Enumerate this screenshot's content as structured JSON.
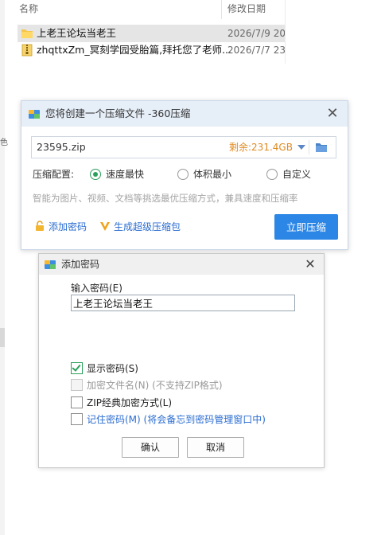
{
  "explorer": {
    "col_name": "名称",
    "col_date": "修改日期",
    "files": [
      {
        "name": "上老王论坛当老王",
        "date": "2026/7/9 20",
        "icon": "folder-icon"
      },
      {
        "name": "zhqttxZm_冥刻学园受胎篇,拜托您了老师...",
        "date": "2026/7/7 23",
        "icon": "zip-archive-icon"
      }
    ],
    "edge_glyph": "色"
  },
  "zip_dialog": {
    "title": "您将创建一个压缩文件 -360压缩",
    "filename": "23595.zip",
    "space_left": "剩余:231.4GB",
    "config_label": "压缩配置:",
    "options": [
      {
        "label": "速度最快",
        "selected": true
      },
      {
        "label": "体积最小",
        "selected": false
      },
      {
        "label": "自定义",
        "selected": false
      }
    ],
    "hint": "智能为图片、视频、文档等挑选最优压缩方式，兼具速度和压缩率",
    "add_password_link": "添加密码",
    "super_pack_link": "生成超级压缩包",
    "compress_button": "立即压缩",
    "accent_color": "#2b86e6"
  },
  "password_dialog": {
    "title": "添加密码",
    "input_label": "输入密码(E)",
    "password_value": "上老王论坛当老王",
    "checkboxes": [
      {
        "label": "显示密码(S)",
        "checked": true,
        "enabled": true
      },
      {
        "label": "加密文件名(N) (不支持ZIP格式)",
        "checked": false,
        "enabled": false
      },
      {
        "label": "ZIP经典加密方式(L)",
        "checked": false,
        "enabled": true
      },
      {
        "label": "记住密码(M) (将会备忘到密码管理窗口中)",
        "checked": false,
        "enabled": true
      }
    ],
    "ok_button": "确认",
    "cancel_button": "取消"
  }
}
